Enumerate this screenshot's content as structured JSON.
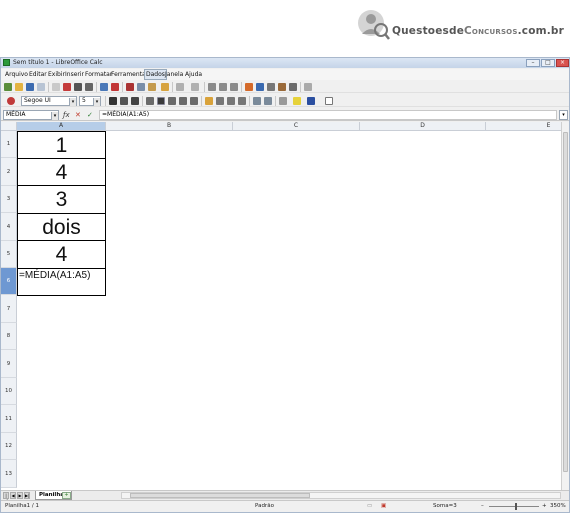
{
  "banner": {
    "logo_text_main": "Questoesde",
    "logo_text_accent": "Concursos",
    "logo_text_suffix": ".com.br"
  },
  "window": {
    "title": "Sem título 1 - LibreOffice Calc"
  },
  "menu": {
    "items": [
      "Arquivo",
      "Editar",
      "Exibir",
      "Inserir",
      "Formatar",
      "Ferramentas",
      "Dados",
      "Janela",
      "Ajuda"
    ],
    "active": "Dados"
  },
  "toolbar2": {
    "font_name": "Segoe UI",
    "font_size": "5"
  },
  "formula_bar": {
    "name_box": "MÉDIA",
    "formula": "=MÉDIA(A1:A5)"
  },
  "columns": [
    "A",
    "B",
    "C",
    "D",
    "E"
  ],
  "rows": [
    "1",
    "2",
    "3",
    "4",
    "5",
    "6",
    "7",
    "8",
    "9",
    "10",
    "11",
    "12",
    "13"
  ],
  "cells": {
    "a1": "1",
    "a2": "4",
    "a3": "3",
    "a4": "dois",
    "a5": "4",
    "a6": "=MÉDIA(A1:A5)"
  },
  "sheet": {
    "tab_name": "Planilha1"
  },
  "status": {
    "sheet": "Planilha1 / 1",
    "style": "Padrão",
    "sum": "Soma=3",
    "zoom": "350%"
  },
  "colors": {
    "selected_row_header": "#6e98d2",
    "selected_col_header": "#b6cde8",
    "titlebar": "#c5d4e8"
  }
}
